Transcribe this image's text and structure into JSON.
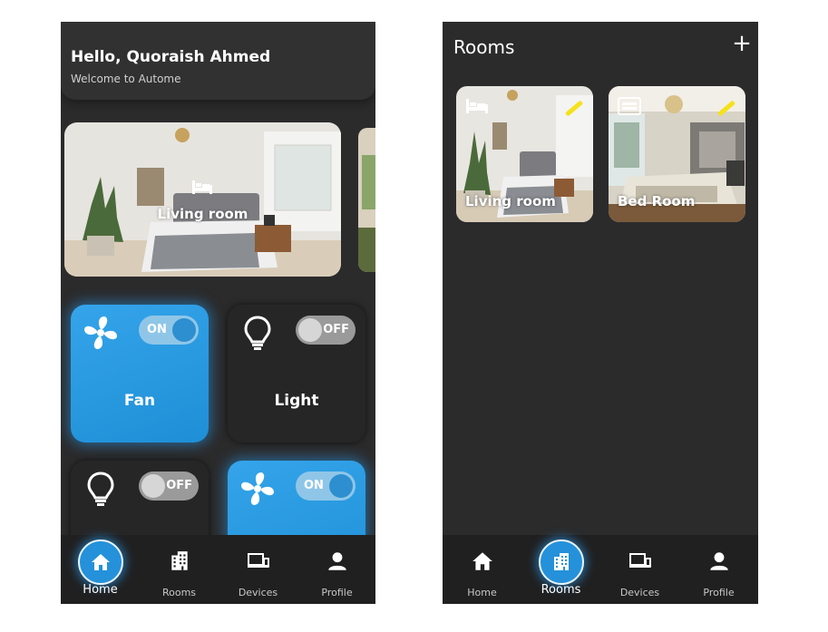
{
  "home": {
    "greeting": "Hello, Quoraish Ahmed",
    "welcome": "Welcome to Autome",
    "featured_room": {
      "label": "Living room",
      "icon": "bed-icon"
    },
    "devices": [
      {
        "name": "Fan",
        "state": "ON",
        "icon": "fan-icon"
      },
      {
        "name": "Light",
        "state": "OFF",
        "icon": "bulb-icon"
      },
      {
        "name": "",
        "state": "OFF",
        "icon": "bulb-icon"
      },
      {
        "name": "",
        "state": "ON",
        "icon": "fan-icon"
      }
    ]
  },
  "rooms_screen": {
    "title": "Rooms",
    "add_label": "+",
    "rooms": [
      {
        "label": "Living room",
        "icon": "bed-icon"
      },
      {
        "label": "Bed Room",
        "icon": "bed-icon"
      }
    ]
  },
  "nav": {
    "items": [
      {
        "label": "Home",
        "icon": "home-icon"
      },
      {
        "label": "Rooms",
        "icon": "building-icon"
      },
      {
        "label": "Devices",
        "icon": "devices-icon"
      },
      {
        "label": "Profile",
        "icon": "person-icon"
      }
    ]
  },
  "colors": {
    "accent": "#2491da",
    "background": "#2b2b2c",
    "tile_off": "#262627",
    "edit_mark": "#f5e21b"
  }
}
